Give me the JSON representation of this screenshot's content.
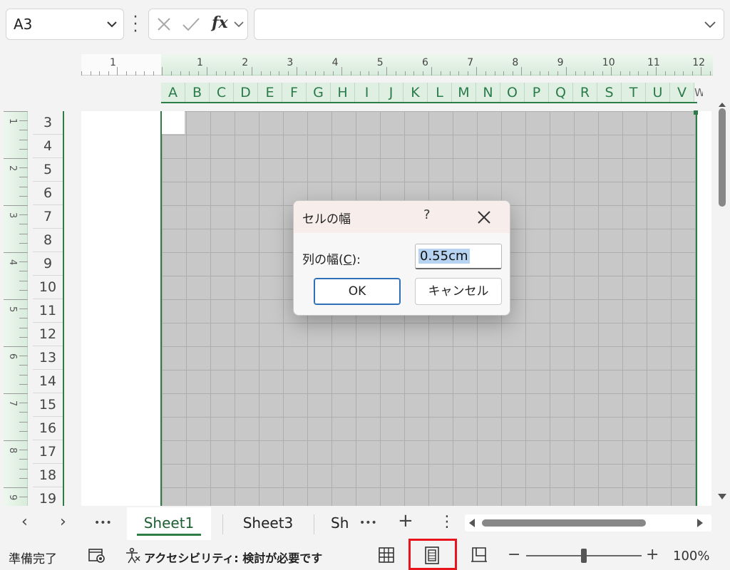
{
  "formula_bar": {
    "name_box": "A3",
    "fx": "fx",
    "formula": ""
  },
  "ruler": {
    "top_numbers": [
      "1",
      "1",
      "2",
      "3",
      "4",
      "5",
      "6",
      "7",
      "8",
      "9",
      "10",
      "11",
      "12"
    ],
    "left_numbers": [
      "1",
      "2",
      "3",
      "4",
      "5",
      "6",
      "7",
      "8",
      "9"
    ]
  },
  "columns": [
    "A",
    "B",
    "C",
    "D",
    "E",
    "F",
    "G",
    "H",
    "I",
    "J",
    "K",
    "L",
    "M",
    "N",
    "O",
    "P",
    "Q",
    "R",
    "S",
    "T",
    "U",
    "V",
    "W"
  ],
  "rows": [
    "3",
    "4",
    "5",
    "6",
    "7",
    "8",
    "9",
    "10",
    "11",
    "12",
    "13",
    "14",
    "15",
    "16",
    "17",
    "18",
    "19"
  ],
  "dialog": {
    "title": "セルの幅",
    "help": "?",
    "label_prefix": "列の幅(",
    "label_key": "C",
    "label_suffix": "):",
    "value": "0.55cm",
    "ok": "OK",
    "cancel": "キャンセル"
  },
  "tabs": {
    "prev": "‹",
    "next": "›",
    "more": "•••",
    "sheets": [
      "Sheet1",
      "Sheet3",
      "Sh"
    ],
    "more2": "•••",
    "add": "+",
    "menu": "⋮"
  },
  "status": {
    "ready": "準備完了",
    "accessibility": "アクセシビリティ: 検討が必要です",
    "zoom_minus": "−",
    "zoom_plus": "+",
    "zoom": "100%"
  },
  "colors": {
    "accent_green": "#2e7d47",
    "highlight_red": "#e8161c",
    "selection_blue": "#b6d4f2"
  },
  "icons": [
    "chevron-down-icon",
    "cancel-x-icon",
    "check-icon",
    "close-icon",
    "macro-record-icon",
    "accessibility-icon",
    "normal-view-icon",
    "page-layout-view-icon",
    "page-break-view-icon"
  ]
}
